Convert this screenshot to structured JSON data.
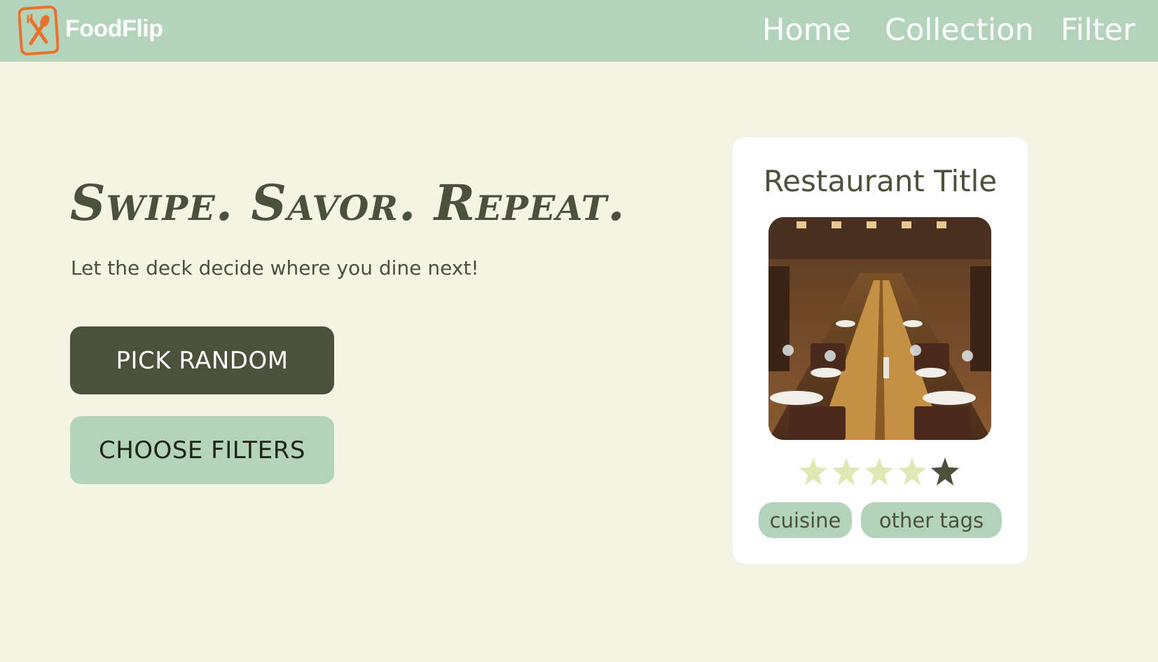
{
  "header": {
    "brand": "FoodFlip",
    "nav": [
      {
        "label": "Home"
      },
      {
        "label": "Collection"
      },
      {
        "label": "Filter"
      }
    ]
  },
  "hero": {
    "title": "Swipe. Savor. Repeat.",
    "subtitle": "Let the deck decide where you dine next!",
    "primary_button": "PICK RANDOM",
    "secondary_button": "CHOOSE FILTERS"
  },
  "card": {
    "title": "Restaurant Title",
    "rating": 4,
    "rating_max": 5,
    "tags": [
      "cuisine",
      "other tags"
    ]
  },
  "colors": {
    "background": "#f4f4e4",
    "nav": "#b3d3ba",
    "dark": "#4b513a",
    "star_filled": "#e0e8b4",
    "star_empty": "#4b513a",
    "logo": "#e8712c"
  }
}
